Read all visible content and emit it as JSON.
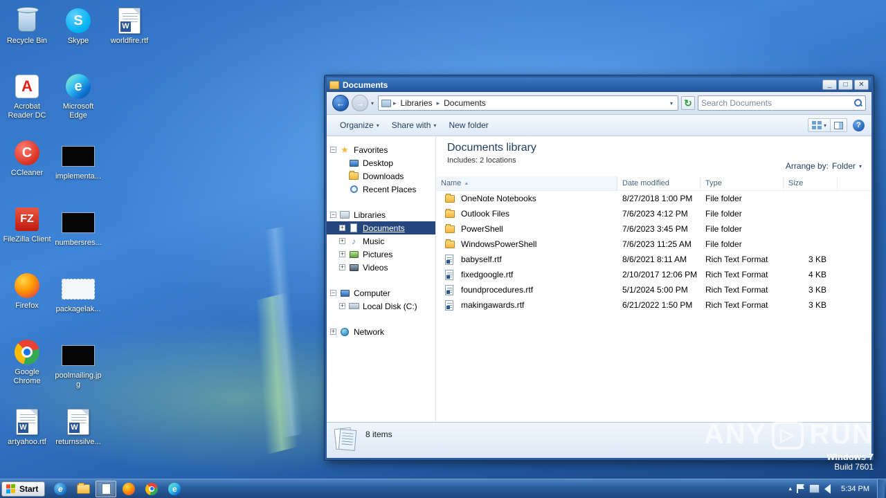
{
  "icons": {
    "minimize": "_",
    "maximize": "□",
    "close": "✕",
    "back_arrow": "←",
    "forward_arrow": "→",
    "refresh": "↻",
    "chevron_down": "▾",
    "breadcrumb_sep": "▸",
    "sort_asc": "▲",
    "expand": "+",
    "collapse": "−",
    "star": "★",
    "music_note": "♪",
    "help": "?",
    "play": "▷",
    "tray_chevron": "▴",
    "skype_s": "S",
    "ccleaner_c": "C",
    "acrobat_a": "A",
    "filezilla_fz": "FZ",
    "word_w": "W",
    "ie_e": "e"
  },
  "desktop": {
    "icons": [
      {
        "label": "Recycle Bin"
      },
      {
        "label": "Skype"
      },
      {
        "label": "worldfire.rtf"
      },
      {
        "label": "Acrobat Reader DC"
      },
      {
        "label": "Microsoft Edge"
      },
      {
        "label": "CCleaner"
      },
      {
        "label": "implementa..."
      },
      {
        "label": "FileZilla Client"
      },
      {
        "label": "numbersres..."
      },
      {
        "label": "Firefox"
      },
      {
        "label": "packagelak..."
      },
      {
        "label": "Google Chrome"
      },
      {
        "label": "poolmailing.jpg"
      },
      {
        "label": "artyahoo.rtf"
      },
      {
        "label": "returnssilve..."
      }
    ],
    "watermark": {
      "left": "ANY",
      "right": "RUN",
      "os": "Windows 7",
      "build": "Build 7601"
    }
  },
  "explorer": {
    "title": "Documents",
    "nav": {
      "breadcrumb": [
        "Libraries",
        "Documents"
      ],
      "search_placeholder": "Search Documents"
    },
    "toolbar": {
      "organize": "Organize",
      "share_with": "Share with",
      "new_folder": "New folder"
    },
    "sidebar": {
      "favorites": {
        "label": "Favorites",
        "items": [
          "Desktop",
          "Downloads",
          "Recent Places"
        ]
      },
      "libraries": {
        "label": "Libraries",
        "items": [
          "Documents",
          "Music",
          "Pictures",
          "Videos"
        ]
      },
      "computer": {
        "label": "Computer",
        "items": [
          "Local Disk (C:)"
        ]
      },
      "network": {
        "label": "Network"
      }
    },
    "header": {
      "title": "Documents library",
      "subtitle": "Includes:  2 locations",
      "arrange_label": "Arrange by:",
      "arrange_value": "Folder"
    },
    "columns": {
      "name": "Name",
      "modified": "Date modified",
      "type": "Type",
      "size": "Size"
    },
    "files": [
      {
        "name": "OneNote Notebooks",
        "modified": "8/27/2018 1:00 PM",
        "type": "File folder",
        "size": ""
      },
      {
        "name": "Outlook Files",
        "modified": "7/6/2023 4:12 PM",
        "type": "File folder",
        "size": ""
      },
      {
        "name": "PowerShell",
        "modified": "7/6/2023 3:45 PM",
        "type": "File folder",
        "size": ""
      },
      {
        "name": "WindowsPowerShell",
        "modified": "7/6/2023 11:25 AM",
        "type": "File folder",
        "size": ""
      },
      {
        "name": "babyself.rtf",
        "modified": "8/6/2021 8:11 AM",
        "type": "Rich Text Format",
        "size": "3 KB"
      },
      {
        "name": "fixedgoogle.rtf",
        "modified": "2/10/2017 12:06 PM",
        "type": "Rich Text Format",
        "size": "4 KB"
      },
      {
        "name": "foundprocedures.rtf",
        "modified": "5/1/2024 5:00 PM",
        "type": "Rich Text Format",
        "size": "3 KB"
      },
      {
        "name": "makingawards.rtf",
        "modified": "6/21/2022 1:50 PM",
        "type": "Rich Text Format",
        "size": "3 KB"
      }
    ],
    "status": "8 items"
  },
  "taskbar": {
    "start_label": "Start",
    "clock": "5:34 PM"
  }
}
